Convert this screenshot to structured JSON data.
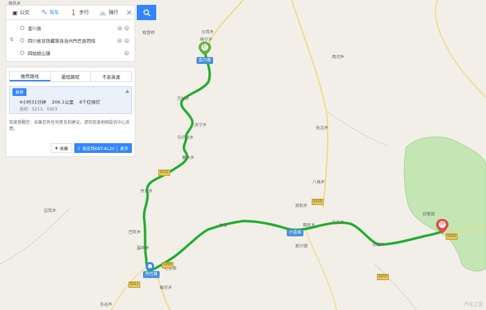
{
  "mode_tabs": [
    {
      "label": "公交",
      "icon": "bus-icon",
      "active": false
    },
    {
      "label": "驾车",
      "icon": "car-icon",
      "active": true
    },
    {
      "label": "步行",
      "icon": "walk-icon",
      "active": false
    },
    {
      "label": "骑行",
      "icon": "bike-icon",
      "active": false
    }
  ],
  "inputs": {
    "start": "金川县",
    "via": "四川省甘孜藏族自治州丹巴县团结",
    "end": "四姑娘山镇"
  },
  "results": {
    "tabs": [
      "推荐路线",
      "最短路程",
      "不走高速"
    ],
    "route": {
      "tag": "推荐",
      "time": "4小时31分钟",
      "distance": "206.1公里",
      "lights": "6个红绿灯",
      "via": "途经：S211、S303"
    },
    "note": "百度提醒您：如果您有任何意见和建议，请到百度地图投诉中心反馈。",
    "fav_label": "收藏",
    "send_label": "发送到KNT-AL20",
    "more_label": "更多"
  },
  "map": {
    "city_labels": [
      {
        "text": "金川县"
      },
      {
        "text": "小金县"
      },
      {
        "text": "丹巴县"
      }
    ],
    "place_labels": [
      "俄热乡",
      "沙耳乡",
      "咯尔乡",
      "观音桥",
      "万林乡",
      "庆宁乡",
      "马尔邦乡",
      "集沐乡",
      "丹东乡",
      "巴旺乡",
      "聂呷乡",
      "格宗乡",
      "美兴镇",
      "八角乡",
      "双柏乡",
      "日隆镇",
      "两河乡",
      "抚边乡",
      "木坡",
      "窝底乡",
      "达维乡",
      "东谷乡",
      "宅垄镇",
      "边耳乡",
      "沃日乡"
    ],
    "road_shields": [
      "S211",
      "S303",
      "S210",
      "S211",
      "S303",
      "S210"
    ],
    "marker_start": "起",
    "marker_end": "终",
    "colors": {
      "route": "#2db52d",
      "forest": "#bfe3b1",
      "road": "#f7e08a",
      "accent": "#3385ff"
    },
    "watermark": "汽车之家"
  }
}
